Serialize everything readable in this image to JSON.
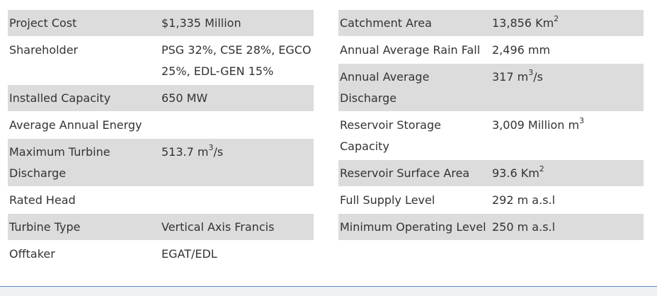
{
  "left_table": [
    {
      "label": "Project Cost",
      "value": "$1,335 Million",
      "value_sup": "",
      "value_tail": "",
      "shaded": true
    },
    {
      "label": "Shareholder",
      "value": "PSG 32%, CSE 28%, EGCO 25%, EDL-GEN 15%",
      "value_sup": "",
      "value_tail": "",
      "shaded": false
    },
    {
      "label": "Installed Capacity",
      "value": "650 MW",
      "value_sup": "",
      "value_tail": "",
      "shaded": true
    },
    {
      "label": "Average Annual Energy",
      "value": "",
      "value_sup": "",
      "value_tail": "",
      "shaded": false
    },
    {
      "label": "Maximum Turbine Discharge",
      "value": "513.7 m",
      "value_sup": "3",
      "value_tail": "/s",
      "shaded": true
    },
    {
      "label": "Rated Head",
      "value": "",
      "value_sup": "",
      "value_tail": "",
      "shaded": false
    },
    {
      "label": "Turbine Type",
      "value": "Vertical Axis Francis",
      "value_sup": "",
      "value_tail": "",
      "shaded": true
    },
    {
      "label": "Offtaker",
      "value": "EGAT/EDL",
      "value_sup": "",
      "value_tail": "",
      "shaded": false
    }
  ],
  "right_table": [
    {
      "label": "Catchment Area",
      "value": "13,856 Km",
      "value_sup": "2",
      "value_tail": "",
      "shaded": true
    },
    {
      "label": "Annual Average Rain Fall",
      "value": "2,496 mm",
      "value_sup": "",
      "value_tail": "",
      "shaded": false
    },
    {
      "label": "Annual Average Discharge",
      "value": "317 m",
      "value_sup": "3",
      "value_tail": "/s",
      "shaded": true
    },
    {
      "label": "Reservoir Storage Capacity",
      "value": "3,009 Million m",
      "value_sup": "3",
      "value_tail": "",
      "shaded": false
    },
    {
      "label": "Reservoir Surface Area",
      "value": "93.6 Km",
      "value_sup": "2",
      "value_tail": "",
      "shaded": true
    },
    {
      "label": "Full Supply Level",
      "value": "292 m a.s.l",
      "value_sup": "",
      "value_tail": "",
      "shaded": false
    },
    {
      "label": "Minimum Operating Level",
      "value": "250 m a.s.l",
      "value_sup": "",
      "value_tail": "",
      "shaded": true
    }
  ]
}
